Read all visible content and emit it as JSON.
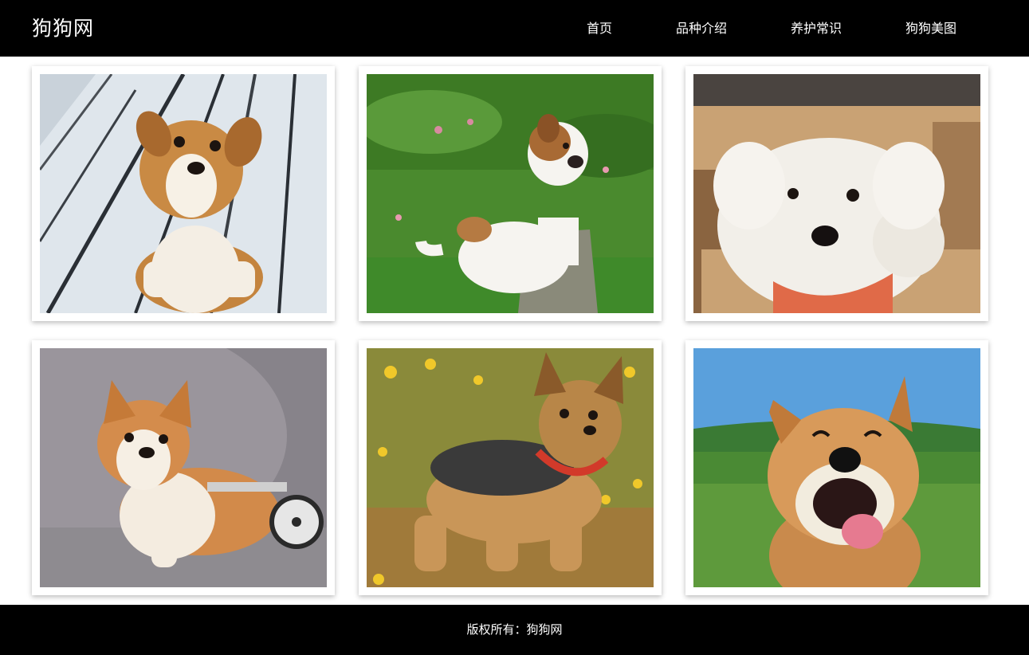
{
  "site": {
    "logo": "狗狗网"
  },
  "nav": {
    "items": [
      {
        "label": "首页"
      },
      {
        "label": "品种介绍"
      },
      {
        "label": "养护常识"
      },
      {
        "label": "狗狗美图"
      }
    ]
  },
  "gallery": {
    "photos": [
      {
        "subject": "puppy-on-wooden-deck"
      },
      {
        "subject": "puppy-on-grass"
      },
      {
        "subject": "white-fluffy-bichon"
      },
      {
        "subject": "corgi-with-wheelchair"
      },
      {
        "subject": "yorkshire-terrier-in-flowers"
      },
      {
        "subject": "smiling-shiba-inu"
      }
    ]
  },
  "footer": {
    "copyright": "版权所有：狗狗网"
  },
  "colors": {
    "header_bg": "#000000",
    "footer_bg": "#000000",
    "text": "#ffffff",
    "card_bg": "#ffffff"
  }
}
